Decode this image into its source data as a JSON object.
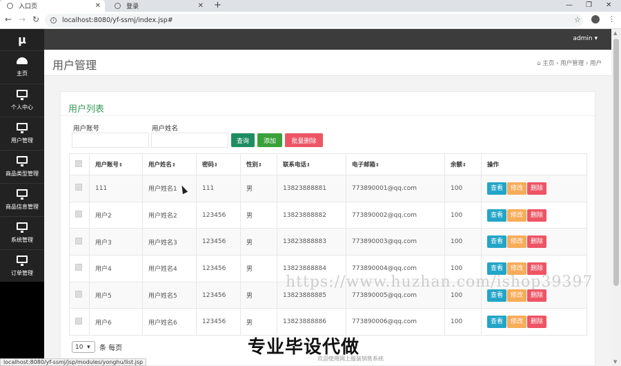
{
  "browser": {
    "tabs": [
      {
        "label": "入口页",
        "active": true
      },
      {
        "label": "登录",
        "active": false
      }
    ],
    "url": "localhost:8080/yf-ssmj/index.jsp#",
    "status_url": "localhost:8080/yf-ssmj/jsp/modules/yonghu/list.jsp"
  },
  "sidebar": {
    "logo": "μ",
    "items": [
      {
        "label": "主页",
        "icon": "dashboard-icon"
      },
      {
        "label": "个人中心",
        "icon": "monitor-icon"
      },
      {
        "label": "用户管理",
        "icon": "monitor-icon"
      },
      {
        "label": "商品类型管理",
        "icon": "monitor-icon"
      },
      {
        "label": "商品信息管理",
        "icon": "monitor-icon"
      },
      {
        "label": "系统管理",
        "icon": "monitor-icon"
      },
      {
        "label": "订单管理",
        "icon": "monitor-icon"
      }
    ]
  },
  "topnav": {
    "user": "admin ▾"
  },
  "page": {
    "title": "用户管理",
    "breadcrumb": [
      "主页",
      "用户管理",
      "用户"
    ]
  },
  "panel": {
    "title": "用户列表",
    "search": {
      "account_label": "用户账号",
      "name_label": "用户姓名",
      "query_button": "查询",
      "add_button": "添加",
      "batch_delete_button": "批量删除"
    }
  },
  "table": {
    "columns": [
      "用户账号",
      "用户姓名",
      "密码",
      "性别",
      "联系电话",
      "电子邮箱",
      "余额",
      "操作"
    ],
    "rows": [
      {
        "account": "111",
        "name": "用户姓名1",
        "password": "111",
        "gender": "男",
        "phone": "13823888881",
        "email": "773890001@qq.com",
        "balance": "100"
      },
      {
        "account": "用户2",
        "name": "用户姓名2",
        "password": "123456",
        "gender": "男",
        "phone": "13823888882",
        "email": "773890002@qq.com",
        "balance": "100"
      },
      {
        "account": "用户3",
        "name": "用户姓名3",
        "password": "123456",
        "gender": "男",
        "phone": "13823888883",
        "email": "773890003@qq.com",
        "balance": "100"
      },
      {
        "account": "用户4",
        "name": "用户姓名4",
        "password": "123456",
        "gender": "男",
        "phone": "13823888884",
        "email": "773890004@qq.com",
        "balance": "100"
      },
      {
        "account": "用户5",
        "name": "用户姓名5",
        "password": "123456",
        "gender": "男",
        "phone": "13823888885",
        "email": "773890005@qq.com",
        "balance": "100"
      },
      {
        "account": "用户6",
        "name": "用户姓名6",
        "password": "123456",
        "gender": "男",
        "phone": "13823888886",
        "email": "773890006@qq.com",
        "balance": "100"
      }
    ],
    "actions": {
      "view": "查看",
      "edit": "修改",
      "delete": "删除"
    }
  },
  "pager": {
    "page_size": "10",
    "suffix": "条 每页"
  },
  "watermarks": {
    "url": "https://www.huzhan.com/ishop39397",
    "cn": "专业毕设代做",
    "footer": "欢迎使用网上服装销售系统"
  }
}
